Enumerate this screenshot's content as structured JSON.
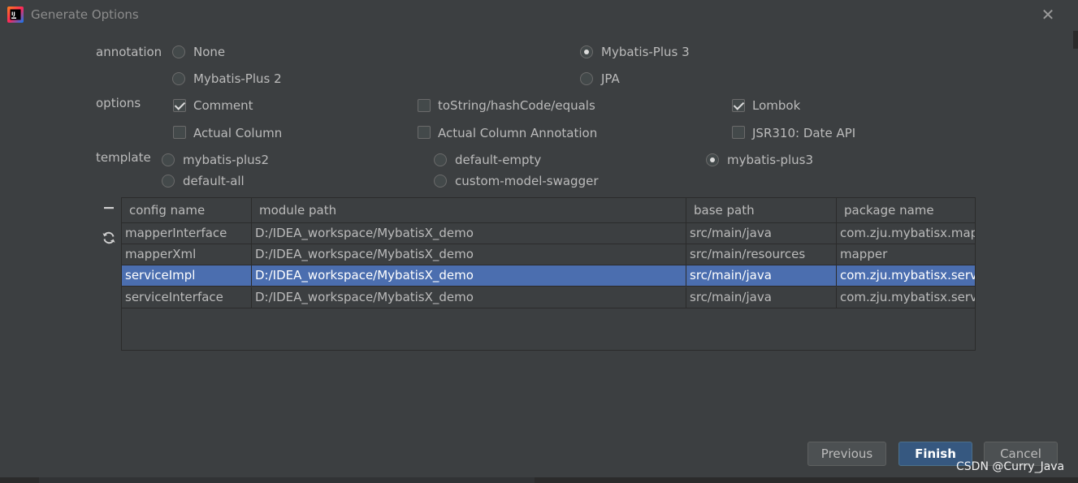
{
  "window": {
    "title": "Generate Options",
    "close_glyph": "✕",
    "app_icon": "intellij-idea-icon"
  },
  "annotation": {
    "label": "annotation",
    "options": [
      {
        "label": "None",
        "selected": false
      },
      {
        "label": "Mybatis-Plus 3",
        "selected": true
      },
      {
        "label": "Mybatis-Plus 2",
        "selected": false
      },
      {
        "label": "JPA",
        "selected": false
      }
    ]
  },
  "options": {
    "label": "options",
    "items": [
      {
        "label": "Comment",
        "checked": true
      },
      {
        "label": "toString/hashCode/equals",
        "checked": false
      },
      {
        "label": "Lombok",
        "checked": true
      },
      {
        "label": "Actual Column",
        "checked": false
      },
      {
        "label": "Actual Column Annotation",
        "checked": false
      },
      {
        "label": "JSR310: Date API",
        "checked": false
      }
    ]
  },
  "template": {
    "label": "template",
    "options": [
      {
        "label": "mybatis-plus2",
        "selected": false
      },
      {
        "label": "default-empty",
        "selected": false
      },
      {
        "label": "mybatis-plus3",
        "selected": true
      },
      {
        "label": "default-all",
        "selected": false
      },
      {
        "label": "custom-model-swagger",
        "selected": false
      }
    ]
  },
  "table": {
    "toolbar": {
      "remove_icon": "minus-icon",
      "refresh_icon": "refresh-icon"
    },
    "columns": [
      "config name",
      "module path",
      "base path",
      "package name"
    ],
    "rows": [
      {
        "cells": [
          "mapperInterface",
          "D:/IDEA_workspace/MybatisX_demo",
          "src/main/java",
          "com.zju.mybatisx.mapper"
        ],
        "selected": false
      },
      {
        "cells": [
          "mapperXml",
          "D:/IDEA_workspace/MybatisX_demo",
          "src/main/resources",
          "mapper"
        ],
        "selected": false
      },
      {
        "cells": [
          "serviceImpl",
          "D:/IDEA_workspace/MybatisX_demo",
          "src/main/java",
          "com.zju.mybatisx.service.impl"
        ],
        "selected": true
      },
      {
        "cells": [
          "serviceInterface",
          "D:/IDEA_workspace/MybatisX_demo",
          "src/main/java",
          "com.zju.mybatisx.service"
        ],
        "selected": false
      }
    ]
  },
  "buttons": {
    "previous": "Previous",
    "finish": "Finish",
    "cancel": "Cancel"
  },
  "watermark": "CSDN @Curry_Java",
  "colors": {
    "background": "#3c3f41",
    "selection": "#4b6eaf",
    "primary_button": "#365880"
  }
}
